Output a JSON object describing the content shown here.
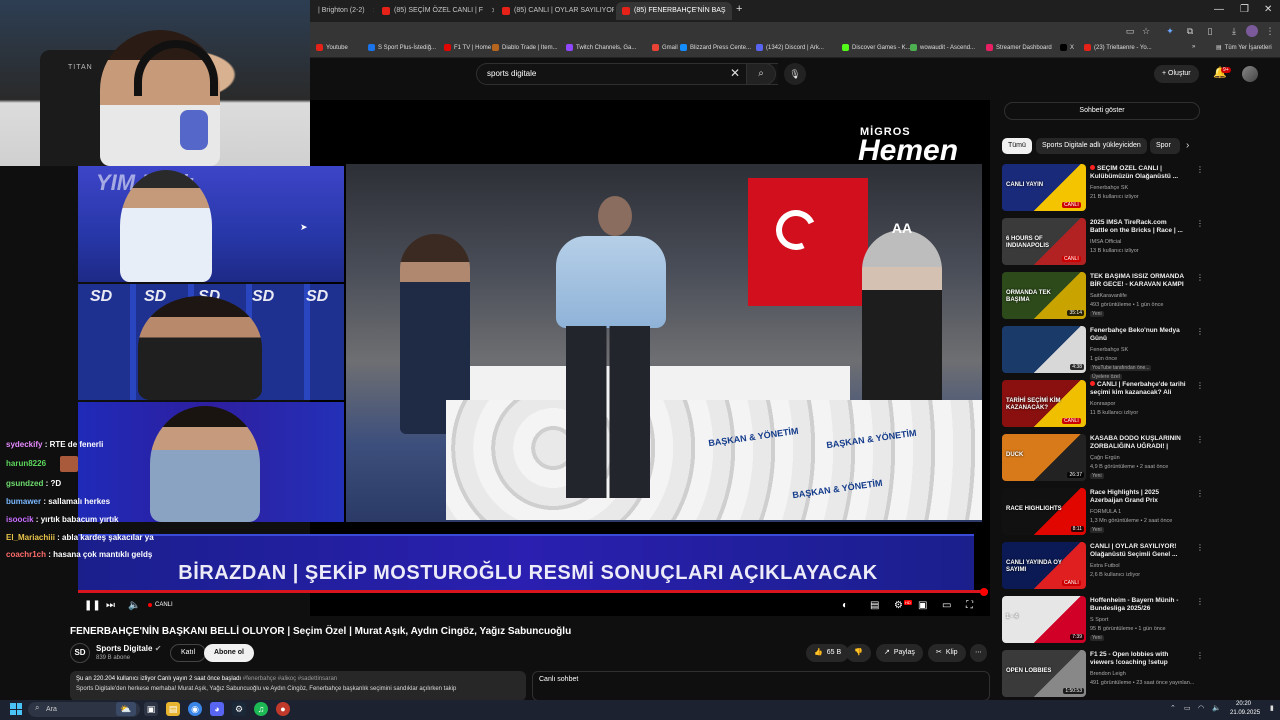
{
  "browser": {
    "tabs": [
      {
        "label": "| Brighton (2-2)"
      },
      {
        "label": "(85) SEÇİM ÖZEL CANLI | F"
      },
      {
        "label": "(85) CANLI | OYLAR SAYILIYOR|"
      },
      {
        "label": "(85) FENERBAHÇE'NİN BAŞ"
      }
    ],
    "bookmarks": [
      {
        "label": "Youtube",
        "color": "#e62117"
      },
      {
        "label": "S Sport Plus-İstediğ...",
        "color": "#1a73e8"
      },
      {
        "label": "F1 TV | Home",
        "color": "#e10600"
      },
      {
        "label": "Diablo Trade | Item...",
        "color": "#b5651d"
      },
      {
        "label": "Twitch Channels, Ga...",
        "color": "#9147ff"
      },
      {
        "label": "Gmail",
        "color": "#ea4335"
      },
      {
        "label": "Blizzard Press Cente...",
        "color": "#148eff"
      },
      {
        "label": "(1342) Discord | Ark...",
        "color": "#5865f2"
      },
      {
        "label": "Discover Games - K...",
        "color": "#53fc18"
      },
      {
        "label": "wowaudit - Ascend...",
        "color": "#4caf50"
      },
      {
        "label": "Streamer Dashboard",
        "color": "#e91e63"
      },
      {
        "label": "X",
        "color": "#000000"
      },
      {
        "label": "(23) Trieltaenre - Yo...",
        "color": "#e62117"
      }
    ],
    "all_bookmarks": "Tüm Yer İşaretleri"
  },
  "header": {
    "search_value": "sports digitale",
    "create_label": "Oluştur",
    "notif_count": "9+"
  },
  "webcam": {
    "chair_label": "TITAN"
  },
  "stream": {
    "panel_title": "YIM Baslı",
    "sd_logo": "SD",
    "banner": "BİRAZDAN | ŞEKİP MOSTUROĞLU RESMİ SONUÇLARI AÇIKLAYACAK",
    "migros": "MİGROS",
    "hemen": "Hemen",
    "aa_logo": "AA",
    "bag_text_1": "BAŞKAN & YÖNETİM",
    "bag_text_2": "BAŞKAN & YÖNETİM",
    "bag_text_3": "BAŞKAN & YÖNETİM"
  },
  "chat": [
    {
      "user": "sydeckify",
      "msg": "RTE de fenerli",
      "color": "#e58aff"
    },
    {
      "user": "harun8226",
      "msg": "",
      "color": "#5cd65c"
    },
    {
      "user": "gsundzed",
      "msg": "?D",
      "color": "#6fdc6f"
    },
    {
      "user": "bumawer",
      "msg": "sallamalı herkes",
      "color": "#7ab8ff"
    },
    {
      "user": "isoocik",
      "msg": "yırtık babacum yırtık",
      "color": "#c86dff"
    },
    {
      "user": "El_Mariachiii",
      "msg": "abla kardeş şakacılar ya",
      "color": "#e8c34a"
    },
    {
      "user": "coachr1ch",
      "msg": "hasana çok mantıklı geldş",
      "color": "#ff6b6b"
    }
  ],
  "player": {
    "live_label": "CANLI",
    "hd": "HD"
  },
  "video": {
    "title": "FENERBAHÇE'NİN BAŞKANI BELLİ OLUYOR | Seçim Özel | Murat Aşık, Aydın Cingöz, Yağız Sabuncuoğlu",
    "channel": "Sports Digitale",
    "channel_avatar": "SD",
    "subscribers": "839 B abone",
    "join_label": "Katıl",
    "subscribe_label": "Abone ol",
    "likes": "65 B",
    "share_label": "Paylaş",
    "clip_label": "Klip",
    "desc_line1": "Şu an 220.204 kullanıcı izliyor  Canlı yayın 2 saat önce başladı",
    "desc_tags": "#fenerbahçe #aliкoç #sadettinsaran",
    "desc_line2": "Sports Digitale'den herkese merhaba! Murat Aşık, Yağız Sabuncuoğlu ve Aydın Cingöz, Fenerbahçe başkanlık seçimini sandıklar açılırken takip",
    "livechat_title": "Canlı sohbet"
  },
  "sidebar": {
    "show_chat": "Sohbeti göster",
    "chips": [
      "Tümü",
      "Sports Digitale adlı yükleyiciden",
      "Spor"
    ],
    "items": [
      {
        "title": "SEÇİM ÖZEL CANLI | Kulübümüzün Olağanüstü ...",
        "channel": "Fenerbahçe SK",
        "meta": "21 B kullanıcı izliyor",
        "live": "CANLI",
        "live_dot": true,
        "colors": [
          "#1a2a7a",
          "#f5c400"
        ],
        "overlay": "CANLI YAYIN"
      },
      {
        "title": "2025 IMSA TireRack.com Battle on the Bricks | Race | ...",
        "channel": "IMSA Official",
        "meta": "13 B kullanıcı izliyor",
        "live": "CANLI",
        "colors": [
          "#3a3a3a",
          "#b22222"
        ],
        "overlay": "6 HOURS OF INDIANAPOLIS"
      },
      {
        "title": "TEK BAŞIMA ISSIZ ORMANDA BİR GECE! - KARAVAN KAMPI",
        "channel": "SaitKaravanlife",
        "meta": "493 görüntüleme • 1 gün önce",
        "badge": "Yeni",
        "duration": "35:14",
        "colors": [
          "#2d4a1a",
          "#c9a400"
        ],
        "overlay": "ORMANDA TEK BAŞIMA"
      },
      {
        "title": "Fenerbahçe Beko'nun Medya Günü",
        "channel": "Fenerbahçe SK",
        "meta": "1 gün önce",
        "extra": "YouTube tarafından öne...",
        "badge": "Üyelere özel",
        "duration": "4:38",
        "colors": [
          "#1a3a6a",
          "#d8d8d8"
        ],
        "overlay": ""
      },
      {
        "title": "CANLI | Fenerbahçe'de tarihi seçimi kim kazanacak? Ali Ko...",
        "channel": "Konraspor",
        "meta": "11 B kullanıcı izliyor",
        "live": "CANLI",
        "live_dot": true,
        "colors": [
          "#8a1010",
          "#f0c000"
        ],
        "overlay": "TARİHİ SEÇİMİ KİM KAZANACAK?"
      },
      {
        "title": "KASABA DODO KUŞLARININ ZORBALIĞINA UĞRADI! | Goos...",
        "channel": "Çağrı Ergün",
        "meta": "4,9 B görüntüleme • 2 saat önce",
        "badge": "Yeni",
        "duration": "26:37",
        "colors": [
          "#d87a1a",
          "#222"
        ],
        "overlay": "DUCK"
      },
      {
        "title": "Race Highlights | 2025 Azerbaijan Grand Prix",
        "channel": "FORMULA 1",
        "meta": "1,3 Mn görüntüleme • 2 saat önce",
        "badge": "Yeni",
        "duration": "8:11",
        "colors": [
          "#111",
          "#e10600"
        ],
        "overlay": "RACE HIGHLIGHTS"
      },
      {
        "title": "CANLI | OYLAR SAYILIYOR! Olağanüstü Seçimli Genel ...",
        "channel": "Extra Futbol",
        "meta": "2,6 B kullanıcı izliyor",
        "live": "CANLI",
        "colors": [
          "#0b1a55",
          "#e02020"
        ],
        "overlay": "CANLI YAYINDA OY SAYIMI"
      },
      {
        "title": "Hoffenheim - Bayern Münih - Bundesliga 2025/26",
        "channel": "S Sport",
        "meta": "95 B görüntüleme • 1 gün önce",
        "badge": "Yeni",
        "duration": "7:39",
        "colors": [
          "#e6e6e6",
          "#d00027"
        ],
        "overlay": "1 - 4"
      },
      {
        "title": "F1 25 - Open lobbies with viewers  !coaching !setup",
        "channel": "Brendon Leigh",
        "meta": "491 görüntüleme • 23 saat önce yayınlan...",
        "duration": "1:50:53",
        "colors": [
          "#3a3a3a",
          "#888"
        ],
        "overlay": "OPEN LOBBIES"
      }
    ]
  },
  "taskbar": {
    "search": "Ara",
    "time": "20:20",
    "date": "21.09.2025"
  }
}
